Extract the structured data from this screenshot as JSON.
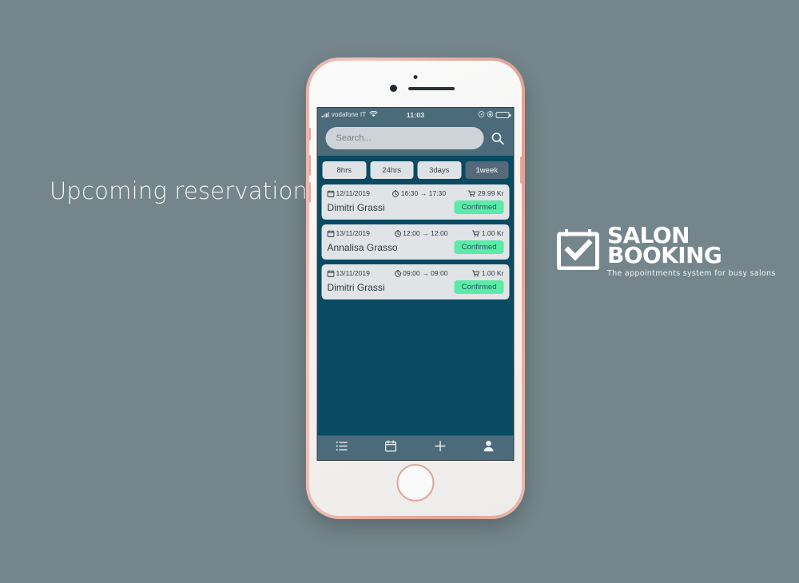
{
  "headline": "Upcoming reservations",
  "colors": {
    "background": "#74868c",
    "screen_dark_teal": "#0a4a63",
    "bar_blue": "#4b6a7a",
    "badge_green": "#5ceaa8",
    "card_gray": "#e0e4e6",
    "phone_frame_rose": "#e7aca1"
  },
  "phone": {
    "statusbar": {
      "signal_icon": "signal-bars-icon",
      "carrier": "vodafone IT",
      "wifi_icon": "wifi-icon",
      "time": "11:03",
      "location_icon": "location-arrow-icon",
      "rotation_lock_icon": "rotation-lock-icon",
      "battery_icon": "battery-full-icon"
    },
    "search": {
      "placeholder": "Search...",
      "value": "",
      "search_icon": "search-icon"
    },
    "filters": [
      {
        "label": "8hrs",
        "active": false
      },
      {
        "label": "24hrs",
        "active": false
      },
      {
        "label": "3days",
        "active": false
      },
      {
        "label": "1week",
        "active": true
      }
    ],
    "reservations": [
      {
        "date_icon": "calendar-icon",
        "date": "12/11/2019",
        "time_icon": "clock-icon",
        "time": "16:30 → 17:30",
        "price_icon": "cart-icon",
        "price": "29.99 Kr",
        "customer": "Dimitri Grassi",
        "status": "Confirmed"
      },
      {
        "date_icon": "calendar-icon",
        "date": "13/11/2019",
        "time_icon": "clock-icon",
        "time": "12:00 → 12:00",
        "price_icon": "cart-icon",
        "price": "1.00 Kr",
        "customer": "Annalisa Grasso",
        "status": "Confirmed"
      },
      {
        "date_icon": "calendar-icon",
        "date": "13/11/2019",
        "time_icon": "clock-icon",
        "time": "09:00 → 09:00",
        "price_icon": "cart-icon",
        "price": "1.00 Kr",
        "customer": "Dimitri Grassi",
        "status": "Confirmed"
      }
    ],
    "tabbar": [
      {
        "icon": "list-icon"
      },
      {
        "icon": "calendar-icon"
      },
      {
        "icon": "plus-icon"
      },
      {
        "icon": "person-icon"
      }
    ]
  },
  "logo": {
    "mark_icon": "calendar-check-icon",
    "line1": "SALON",
    "line2": "BOOKING",
    "tagline": "The appointments system for busy salons"
  }
}
